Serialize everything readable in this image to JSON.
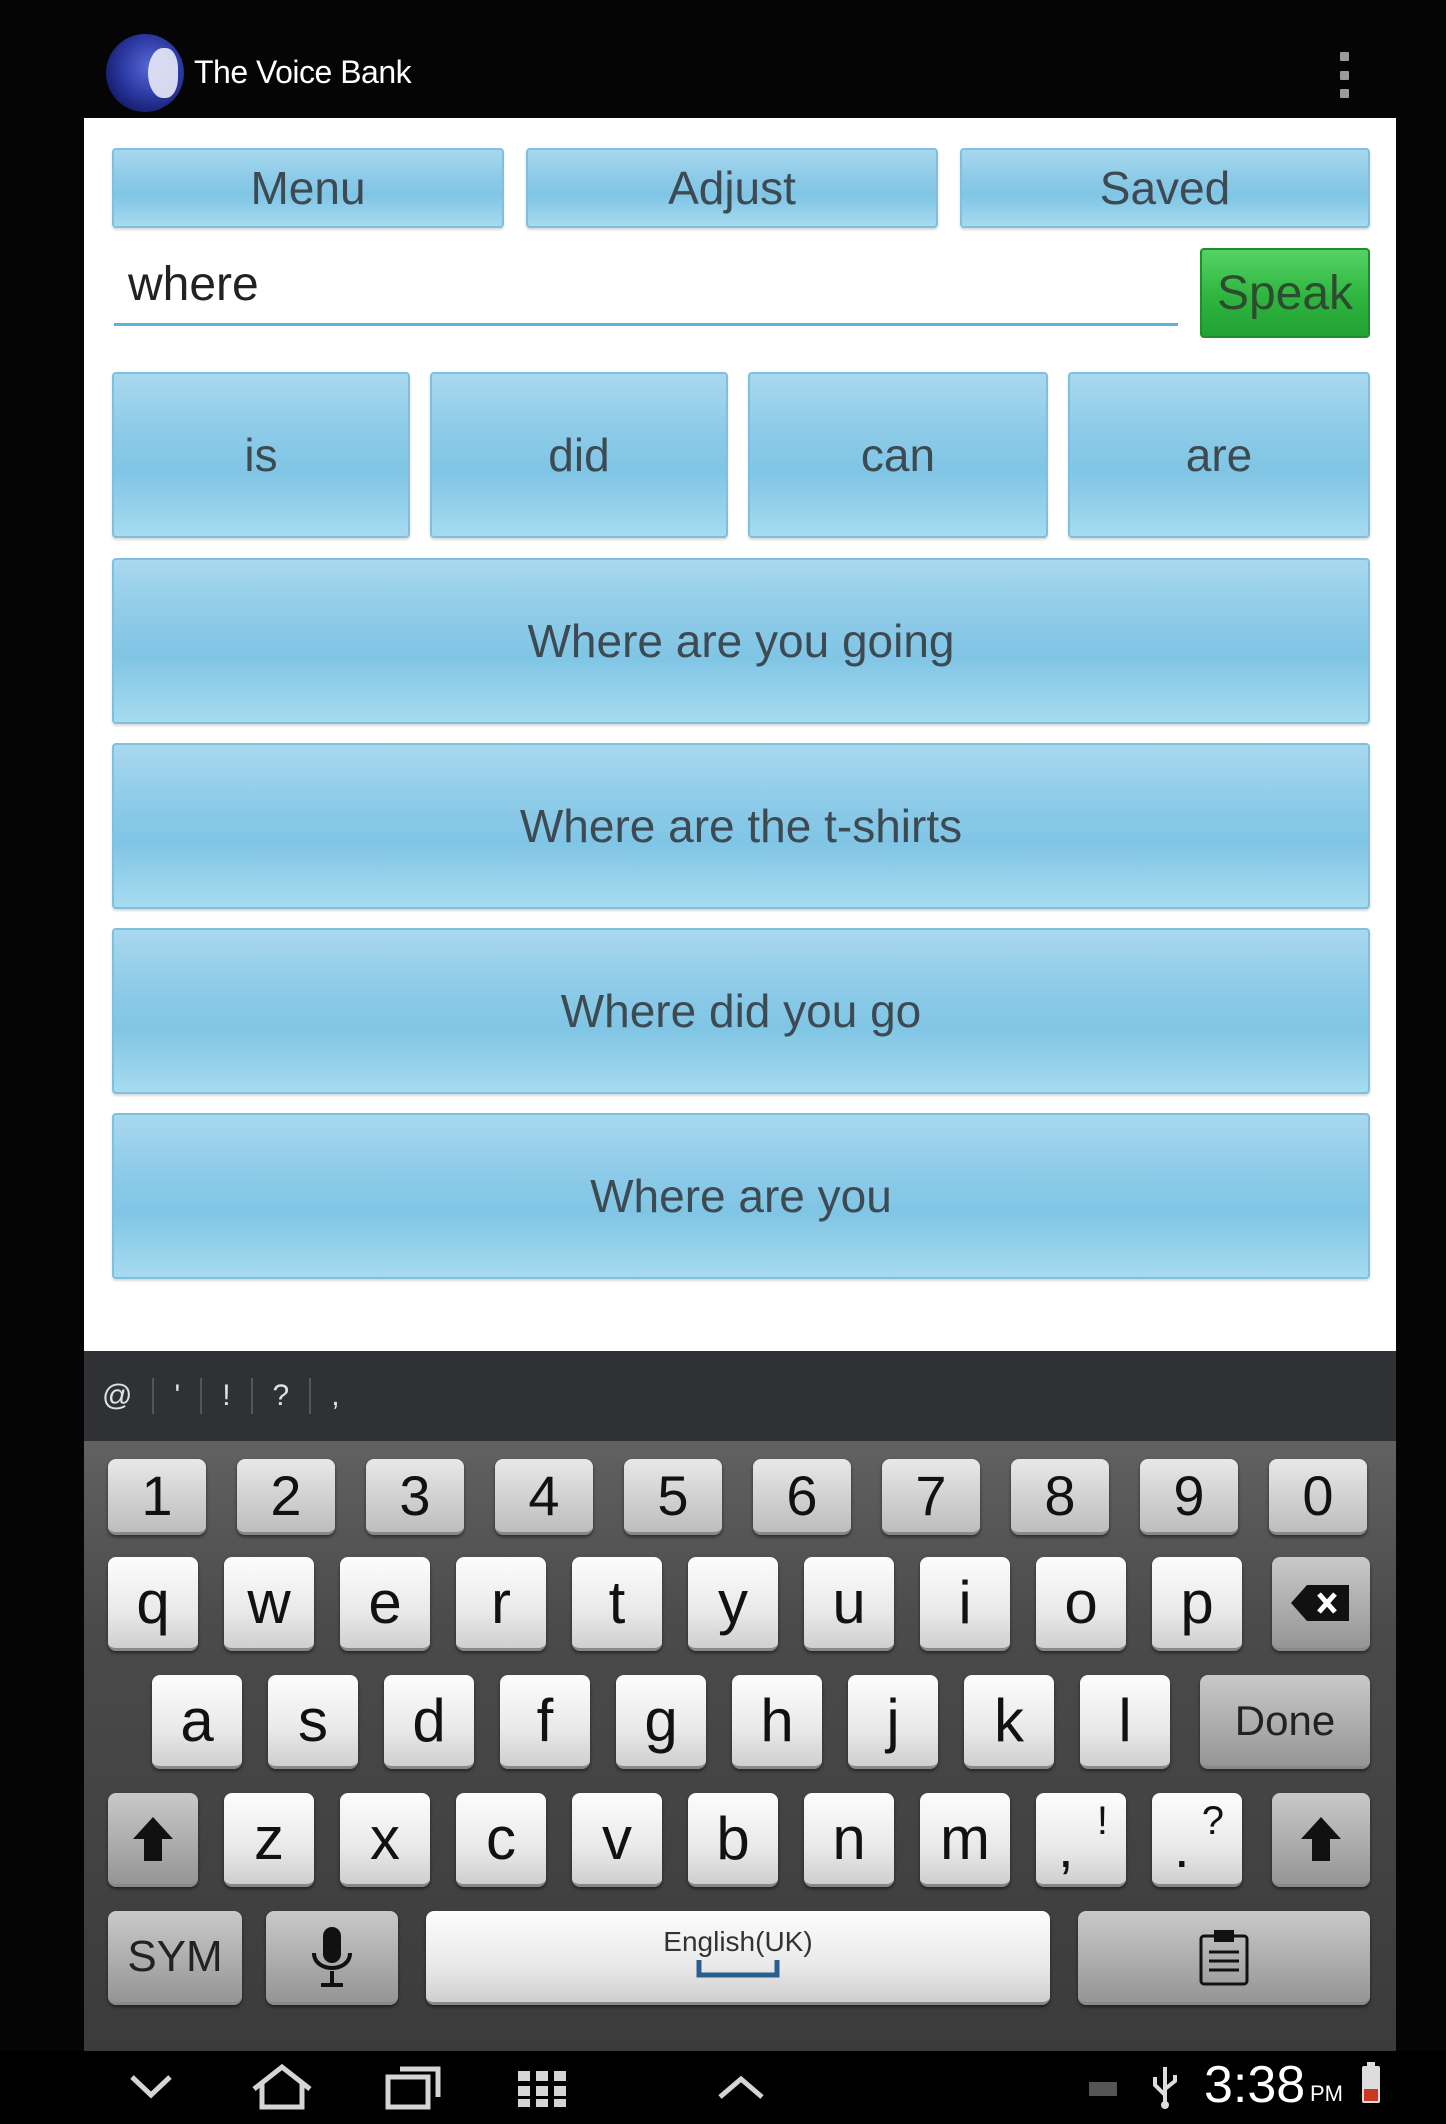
{
  "app": {
    "title": "The Voice Bank"
  },
  "toolbar": {
    "menu_label": "Menu",
    "adjust_label": "Adjust",
    "saved_label": "Saved"
  },
  "input": {
    "value": "where",
    "speak_label": "Speak"
  },
  "word_suggestions": [
    "is",
    "did",
    "can",
    "are"
  ],
  "phrase_suggestions": [
    "Where are you going",
    "Where are the t-shirts",
    "Where did you go",
    "Where are you"
  ],
  "keyboard": {
    "symbol_bar": [
      "@",
      "'",
      "!",
      "?",
      ","
    ],
    "numbers": [
      "1",
      "2",
      "3",
      "4",
      "5",
      "6",
      "7",
      "8",
      "9",
      "0"
    ],
    "row_qwerty": [
      "q",
      "w",
      "e",
      "r",
      "t",
      "y",
      "u",
      "i",
      "o",
      "p"
    ],
    "row_asdf": [
      "a",
      "s",
      "d",
      "f",
      "g",
      "h",
      "j",
      "k",
      "l"
    ],
    "done_label": "Done",
    "row_zxcv": [
      "z",
      "x",
      "c",
      "v",
      "b",
      "n",
      "m"
    ],
    "punct_1": {
      "main": ",",
      "alt": "!"
    },
    "punct_2": {
      "main": ".",
      "alt": "?"
    },
    "sym_label": "SYM",
    "space_label": "English(UK)"
  },
  "status": {
    "time": "3:38",
    "ampm": "PM"
  },
  "icons": {
    "overflow": "overflow-menu-icon",
    "backspace": "backspace-icon",
    "shift": "shift-icon",
    "mic": "microphone-icon",
    "clipboard": "clipboard-icon",
    "nav_back": "chevron-down-icon",
    "nav_home": "home-icon",
    "nav_recents": "recent-apps-icon",
    "nav_grid": "app-grid-icon",
    "nav_up": "chevron-up-icon",
    "usb": "usb-icon",
    "battery": "battery-icon"
  },
  "colors": {
    "accent_blue": "#8dcbe8",
    "speak_green": "#2fb53f",
    "background": "#050505"
  }
}
